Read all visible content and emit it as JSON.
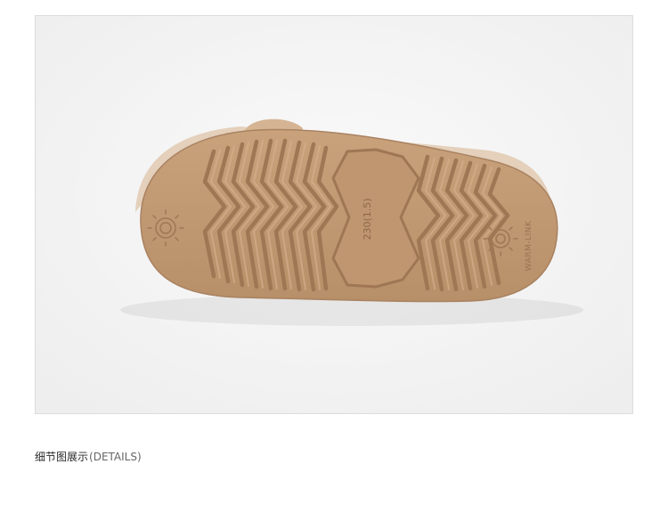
{
  "photo": {
    "subject": "sandal-sole",
    "sole_marking": "230(1.5)",
    "brand_mark": "WARM-LINK"
  },
  "caption": {
    "text_cn": "细节图展示",
    "text_en": "(DETAILS)"
  },
  "colors": {
    "background": "#f5f5f5",
    "sole": "#c19a74",
    "sole_shadow": "#9f7754",
    "sole_highlight": "#d2ad88"
  }
}
